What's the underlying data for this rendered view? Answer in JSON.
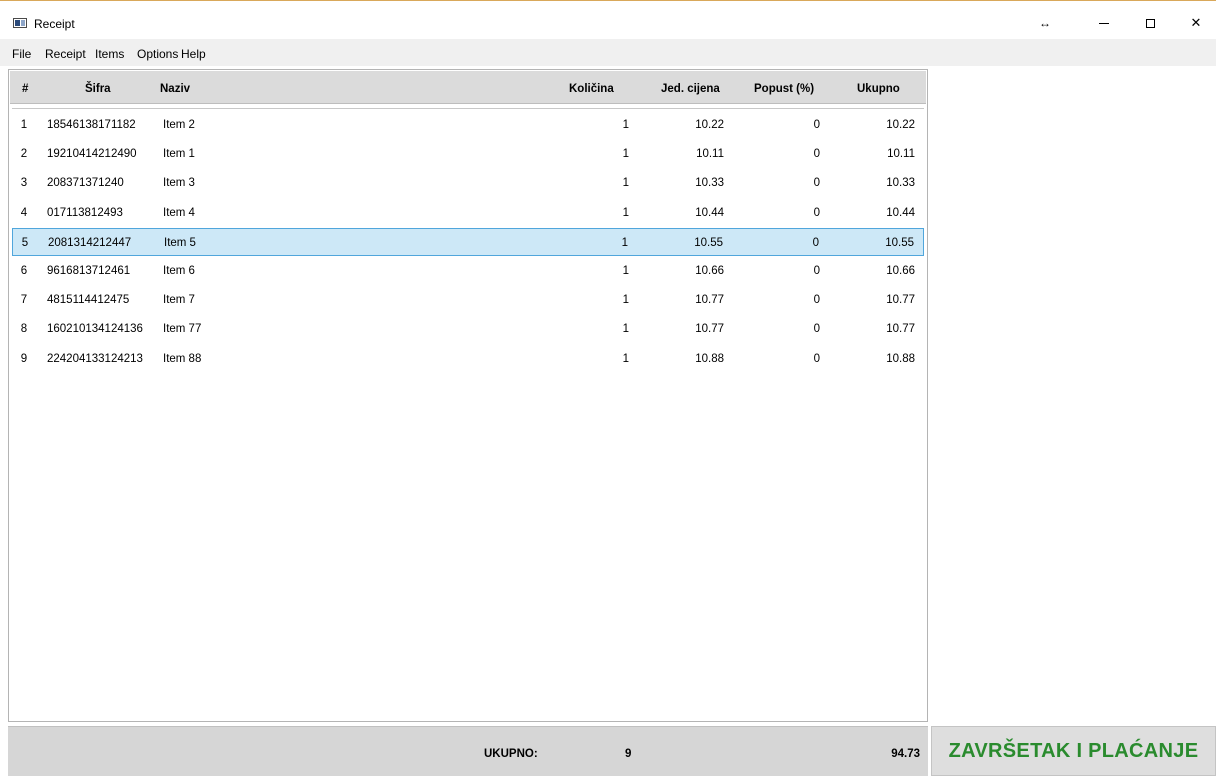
{
  "window": {
    "title": "Receipt",
    "resize_glyph": "↔",
    "close_glyph": "✕"
  },
  "menu": [
    "File",
    "Receipt",
    "Items",
    "Options",
    "Help"
  ],
  "table": {
    "columns": {
      "num": "#",
      "sifra": "Šifra",
      "naziv": "Naziv",
      "kolicina": "Količina",
      "cijena": "Jed. cijena",
      "popust": "Popust (%)",
      "ukupno": "Ukupno"
    },
    "rows": [
      {
        "num": "1",
        "sifra": "18546138171182",
        "naziv": "Item 2",
        "kolicina": "1",
        "cijena": "10.22",
        "popust": "0",
        "ukupno": "10.22"
      },
      {
        "num": "2",
        "sifra": "19210414212490",
        "naziv": "Item 1",
        "kolicina": "1",
        "cijena": "10.11",
        "popust": "0",
        "ukupno": "10.11"
      },
      {
        "num": "3",
        "sifra": "208371371240",
        "naziv": "Item 3",
        "kolicina": "1",
        "cijena": "10.33",
        "popust": "0",
        "ukupno": "10.33"
      },
      {
        "num": "4",
        "sifra": "017113812493",
        "naziv": "Item 4",
        "kolicina": "1",
        "cijena": "10.44",
        "popust": "0",
        "ukupno": "10.44"
      },
      {
        "num": "5",
        "sifra": "2081314212447",
        "naziv": "Item 5",
        "kolicina": "1",
        "cijena": "10.55",
        "popust": "0",
        "ukupno": "10.55"
      },
      {
        "num": "6",
        "sifra": "9616813712461",
        "naziv": "Item 6",
        "kolicina": "1",
        "cijena": "10.66",
        "popust": "0",
        "ukupno": "10.66"
      },
      {
        "num": "7",
        "sifra": "4815114412475",
        "naziv": "Item 7",
        "kolicina": "1",
        "cijena": "10.77",
        "popust": "0",
        "ukupno": "10.77"
      },
      {
        "num": "8",
        "sifra": "160210134124136",
        "naziv": "Item 77",
        "kolicina": "1",
        "cijena": "10.77",
        "popust": "0",
        "ukupno": "10.77"
      },
      {
        "num": "9",
        "sifra": "224204133124213",
        "naziv": "Item 88",
        "kolicina": "1",
        "cijena": "10.88",
        "popust": "0",
        "ukupno": "10.88"
      }
    ],
    "selected_row": 5
  },
  "footer": {
    "label": "UKUPNO:",
    "count": "9",
    "total": "94.73"
  },
  "actions": {
    "finish_label": "ZAVRŠETAK I PLAĆANJE"
  },
  "colors": {
    "finish_text": "#2a8b2e",
    "selection_bg": "#cde8f7",
    "selection_border": "#50a6dc"
  }
}
